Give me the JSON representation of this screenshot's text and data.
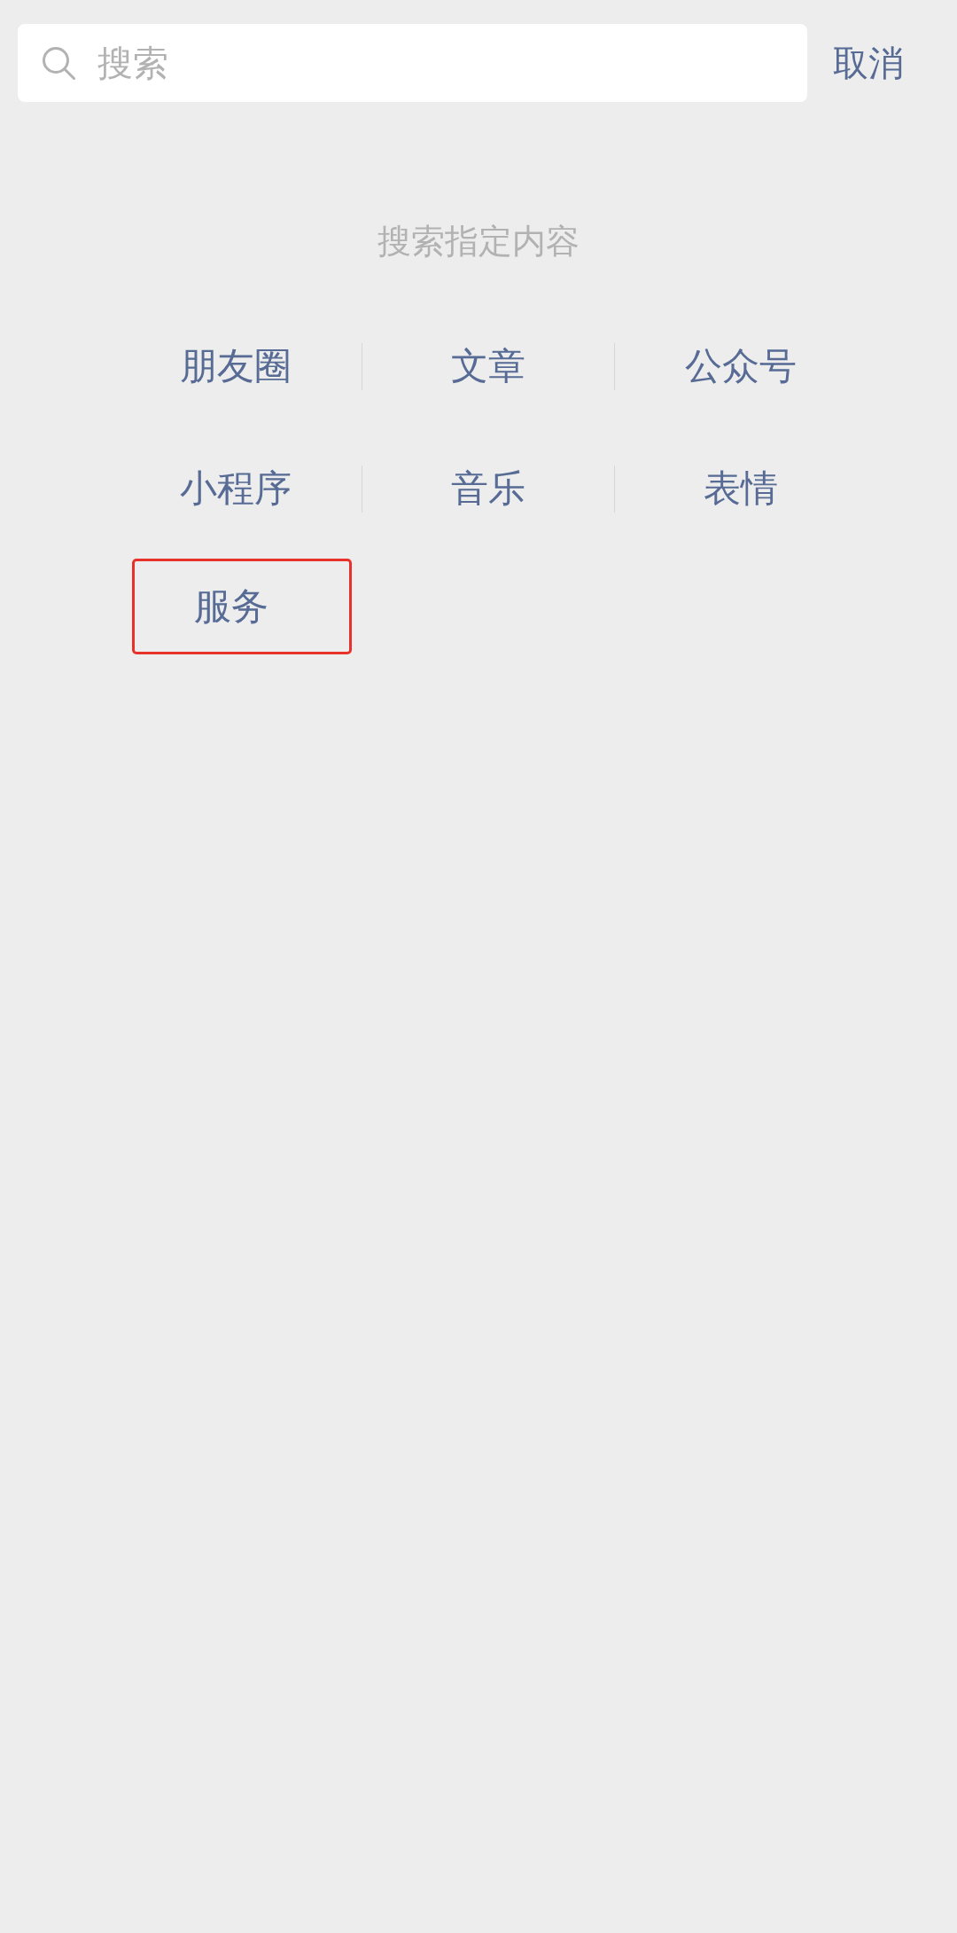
{
  "search_bar": {
    "placeholder": "搜索",
    "cancel": "取消"
  },
  "hint": "搜索指定内容",
  "categories": [
    {
      "label": "朋友圈",
      "highlighted": false
    },
    {
      "label": "文章",
      "highlighted": false
    },
    {
      "label": "公众号",
      "highlighted": false
    },
    {
      "label": "小程序",
      "highlighted": false
    },
    {
      "label": "音乐",
      "highlighted": false
    },
    {
      "label": "表情",
      "highlighted": false
    },
    {
      "label": "服务",
      "highlighted": true
    }
  ]
}
